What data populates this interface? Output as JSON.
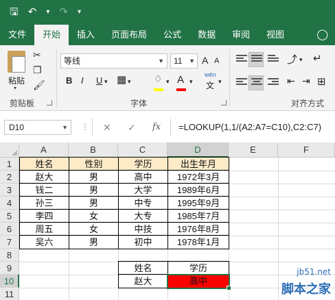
{
  "ribbon_tabs": [
    "文件",
    "开始",
    "插入",
    "页面布局",
    "公式",
    "数据",
    "审阅",
    "视图"
  ],
  "ribbon": {
    "paste_label": "粘贴",
    "clipboard_label": "剪贴板",
    "font_label": "字体",
    "align_label": "对齐方式",
    "font_name": "等线",
    "font_size": "11",
    "bold": "B",
    "italic": "I",
    "underline": "U",
    "grow_font": "A",
    "shrink_font": "A",
    "font_color_glyph": "A",
    "phonetic_top": "wén",
    "phonetic_bottom": "文",
    "accent_colors": {
      "fill": "#ffff00",
      "font": "#ff0000",
      "brand": "#217346"
    }
  },
  "formula_bar": {
    "name_box": "D10",
    "cancel": "✕",
    "enter": "✓",
    "fx": "fx",
    "formula": "=LOOKUP(1,1/(A2:A7=C10),C2:C7)"
  },
  "sheet": {
    "columns": [
      "A",
      "B",
      "C",
      "D",
      "E",
      "F"
    ],
    "rows": [
      "1",
      "2",
      "3",
      "4",
      "5",
      "6",
      "7",
      "8",
      "9",
      "10",
      "11"
    ],
    "header": [
      "姓名",
      "性别",
      "学历",
      "出生年月"
    ],
    "data": [
      [
        "赵大",
        "男",
        "高中",
        "1972年3月"
      ],
      [
        "钱二",
        "男",
        "大学",
        "1989年6月"
      ],
      [
        "孙三",
        "男",
        "中专",
        "1995年9月"
      ],
      [
        "李四",
        "女",
        "大专",
        "1985年7月"
      ],
      [
        "周五",
        "女",
        "中技",
        "1976年8月"
      ],
      [
        "吴六",
        "男",
        "初中",
        "1978年1月"
      ]
    ],
    "lookup": {
      "label_name": "姓名",
      "label_edu": "学历",
      "value_name": "赵大",
      "value_edu": "高中"
    }
  },
  "watermark": {
    "site": "jb51.net",
    "brand": "脚本之家"
  }
}
